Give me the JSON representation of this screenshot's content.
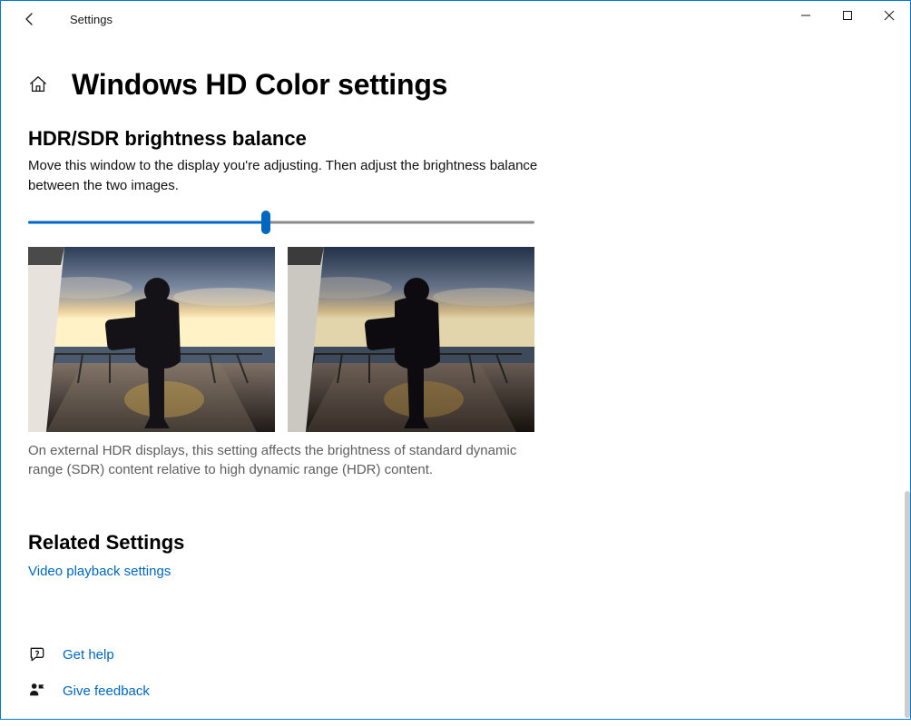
{
  "window": {
    "title": "Settings"
  },
  "page": {
    "title": "Windows HD Color settings"
  },
  "brightness": {
    "heading": "HDR/SDR brightness balance",
    "description": "Move this window to the display you're adjusting. Then adjust the brightness balance between the two images.",
    "slider_percent": 47,
    "note": "On external HDR displays, this setting affects the brightness of standard dynamic range (SDR) content relative to high dynamic range (HDR) content."
  },
  "related": {
    "heading": "Related Settings",
    "links": [
      "Video playback settings"
    ]
  },
  "actions": {
    "help": "Get help",
    "feedback": "Give feedback"
  },
  "colors": {
    "accent": "#0067c0"
  }
}
